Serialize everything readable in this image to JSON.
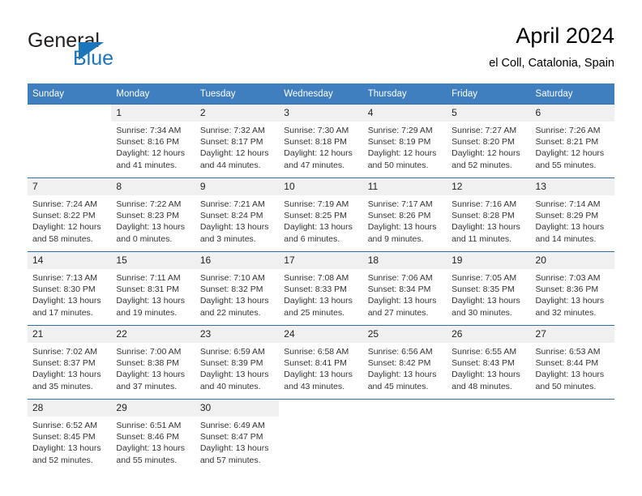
{
  "brand": {
    "word1": "General",
    "word2": "Blue",
    "logo_icon": "triangle-logo-icon",
    "accent_color": "#1b75bb"
  },
  "header": {
    "title": "April 2024",
    "location": "el Coll, Catalonia, Spain"
  },
  "calendar": {
    "header_bg": "#3f7fbf",
    "row_border_color": "#2f6fb0",
    "daynum_bg": "#f0f0f0",
    "weekdays": [
      "Sunday",
      "Monday",
      "Tuesday",
      "Wednesday",
      "Thursday",
      "Friday",
      "Saturday"
    ],
    "weeks": [
      [
        {
          "day": "",
          "lines": []
        },
        {
          "day": "1",
          "lines": [
            "Sunrise: 7:34 AM",
            "Sunset: 8:16 PM",
            "Daylight: 12 hours",
            "and 41 minutes."
          ]
        },
        {
          "day": "2",
          "lines": [
            "Sunrise: 7:32 AM",
            "Sunset: 8:17 PM",
            "Daylight: 12 hours",
            "and 44 minutes."
          ]
        },
        {
          "day": "3",
          "lines": [
            "Sunrise: 7:30 AM",
            "Sunset: 8:18 PM",
            "Daylight: 12 hours",
            "and 47 minutes."
          ]
        },
        {
          "day": "4",
          "lines": [
            "Sunrise: 7:29 AM",
            "Sunset: 8:19 PM",
            "Daylight: 12 hours",
            "and 50 minutes."
          ]
        },
        {
          "day": "5",
          "lines": [
            "Sunrise: 7:27 AM",
            "Sunset: 8:20 PM",
            "Daylight: 12 hours",
            "and 52 minutes."
          ]
        },
        {
          "day": "6",
          "lines": [
            "Sunrise: 7:26 AM",
            "Sunset: 8:21 PM",
            "Daylight: 12 hours",
            "and 55 minutes."
          ]
        }
      ],
      [
        {
          "day": "7",
          "lines": [
            "Sunrise: 7:24 AM",
            "Sunset: 8:22 PM",
            "Daylight: 12 hours",
            "and 58 minutes."
          ]
        },
        {
          "day": "8",
          "lines": [
            "Sunrise: 7:22 AM",
            "Sunset: 8:23 PM",
            "Daylight: 13 hours",
            "and 0 minutes."
          ]
        },
        {
          "day": "9",
          "lines": [
            "Sunrise: 7:21 AM",
            "Sunset: 8:24 PM",
            "Daylight: 13 hours",
            "and 3 minutes."
          ]
        },
        {
          "day": "10",
          "lines": [
            "Sunrise: 7:19 AM",
            "Sunset: 8:25 PM",
            "Daylight: 13 hours",
            "and 6 minutes."
          ]
        },
        {
          "day": "11",
          "lines": [
            "Sunrise: 7:17 AM",
            "Sunset: 8:26 PM",
            "Daylight: 13 hours",
            "and 9 minutes."
          ]
        },
        {
          "day": "12",
          "lines": [
            "Sunrise: 7:16 AM",
            "Sunset: 8:28 PM",
            "Daylight: 13 hours",
            "and 11 minutes."
          ]
        },
        {
          "day": "13",
          "lines": [
            "Sunrise: 7:14 AM",
            "Sunset: 8:29 PM",
            "Daylight: 13 hours",
            "and 14 minutes."
          ]
        }
      ],
      [
        {
          "day": "14",
          "lines": [
            "Sunrise: 7:13 AM",
            "Sunset: 8:30 PM",
            "Daylight: 13 hours",
            "and 17 minutes."
          ]
        },
        {
          "day": "15",
          "lines": [
            "Sunrise: 7:11 AM",
            "Sunset: 8:31 PM",
            "Daylight: 13 hours",
            "and 19 minutes."
          ]
        },
        {
          "day": "16",
          "lines": [
            "Sunrise: 7:10 AM",
            "Sunset: 8:32 PM",
            "Daylight: 13 hours",
            "and 22 minutes."
          ]
        },
        {
          "day": "17",
          "lines": [
            "Sunrise: 7:08 AM",
            "Sunset: 8:33 PM",
            "Daylight: 13 hours",
            "and 25 minutes."
          ]
        },
        {
          "day": "18",
          "lines": [
            "Sunrise: 7:06 AM",
            "Sunset: 8:34 PM",
            "Daylight: 13 hours",
            "and 27 minutes."
          ]
        },
        {
          "day": "19",
          "lines": [
            "Sunrise: 7:05 AM",
            "Sunset: 8:35 PM",
            "Daylight: 13 hours",
            "and 30 minutes."
          ]
        },
        {
          "day": "20",
          "lines": [
            "Sunrise: 7:03 AM",
            "Sunset: 8:36 PM",
            "Daylight: 13 hours",
            "and 32 minutes."
          ]
        }
      ],
      [
        {
          "day": "21",
          "lines": [
            "Sunrise: 7:02 AM",
            "Sunset: 8:37 PM",
            "Daylight: 13 hours",
            "and 35 minutes."
          ]
        },
        {
          "day": "22",
          "lines": [
            "Sunrise: 7:00 AM",
            "Sunset: 8:38 PM",
            "Daylight: 13 hours",
            "and 37 minutes."
          ]
        },
        {
          "day": "23",
          "lines": [
            "Sunrise: 6:59 AM",
            "Sunset: 8:39 PM",
            "Daylight: 13 hours",
            "and 40 minutes."
          ]
        },
        {
          "day": "24",
          "lines": [
            "Sunrise: 6:58 AM",
            "Sunset: 8:41 PM",
            "Daylight: 13 hours",
            "and 43 minutes."
          ]
        },
        {
          "day": "25",
          "lines": [
            "Sunrise: 6:56 AM",
            "Sunset: 8:42 PM",
            "Daylight: 13 hours",
            "and 45 minutes."
          ]
        },
        {
          "day": "26",
          "lines": [
            "Sunrise: 6:55 AM",
            "Sunset: 8:43 PM",
            "Daylight: 13 hours",
            "and 48 minutes."
          ]
        },
        {
          "day": "27",
          "lines": [
            "Sunrise: 6:53 AM",
            "Sunset: 8:44 PM",
            "Daylight: 13 hours",
            "and 50 minutes."
          ]
        }
      ],
      [
        {
          "day": "28",
          "lines": [
            "Sunrise: 6:52 AM",
            "Sunset: 8:45 PM",
            "Daylight: 13 hours",
            "and 52 minutes."
          ]
        },
        {
          "day": "29",
          "lines": [
            "Sunrise: 6:51 AM",
            "Sunset: 8:46 PM",
            "Daylight: 13 hours",
            "and 55 minutes."
          ]
        },
        {
          "day": "30",
          "lines": [
            "Sunrise: 6:49 AM",
            "Sunset: 8:47 PM",
            "Daylight: 13 hours",
            "and 57 minutes."
          ]
        },
        {
          "day": "",
          "lines": []
        },
        {
          "day": "",
          "lines": []
        },
        {
          "day": "",
          "lines": []
        },
        {
          "day": "",
          "lines": []
        }
      ]
    ]
  }
}
